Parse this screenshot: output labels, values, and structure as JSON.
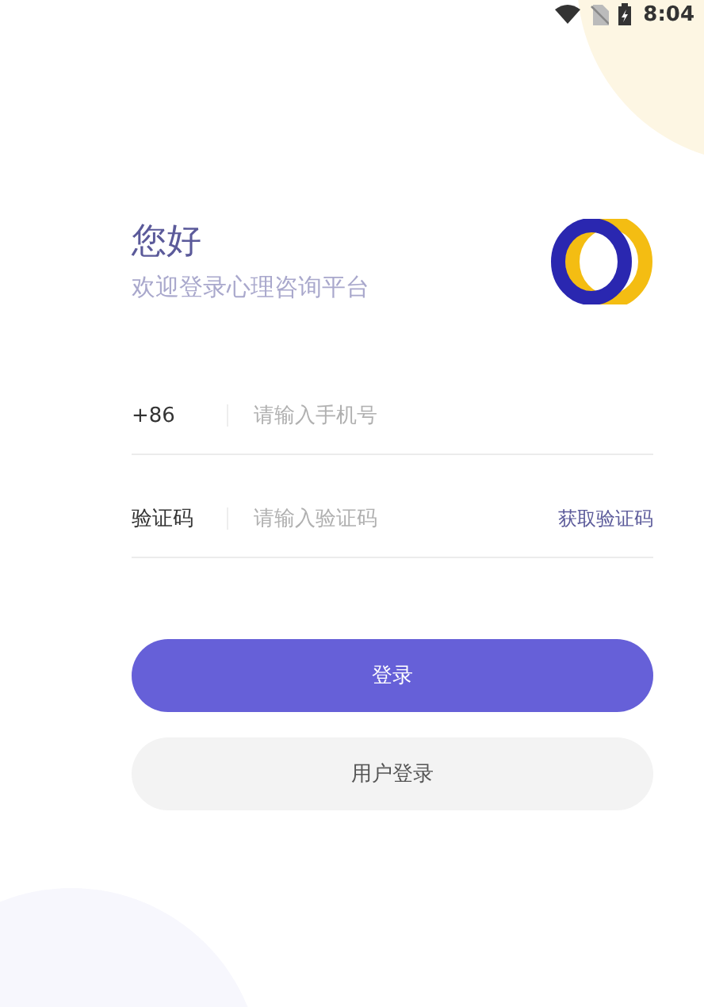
{
  "status_bar": {
    "time": "8:04"
  },
  "greeting": {
    "title": "您好",
    "subtitle": "欢迎登录心理咨询平台"
  },
  "fields": [
    {
      "kind": "phone",
      "label": "+86",
      "placeholder": "请输入手机号"
    },
    {
      "kind": "code",
      "label": "验证码",
      "placeholder": "请输入验证码",
      "action": "获取验证码"
    }
  ],
  "buttons": [
    {
      "kind": "primary",
      "label": "登录"
    },
    {
      "kind": "secondary",
      "label": "用户登录"
    }
  ]
}
